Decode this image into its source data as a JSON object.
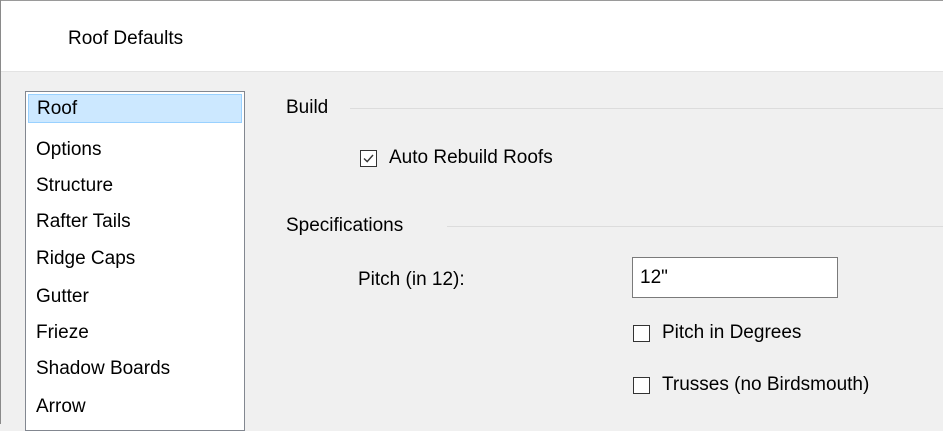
{
  "dialog": {
    "title": "Roof Defaults"
  },
  "sidebar": {
    "items": [
      {
        "label": "Roof",
        "selected": true
      },
      {
        "label": "Options",
        "selected": false
      },
      {
        "label": "Structure",
        "selected": false
      },
      {
        "label": "Rafter Tails",
        "selected": false
      },
      {
        "label": "Ridge Caps",
        "selected": false
      },
      {
        "label": "Gutter",
        "selected": false
      },
      {
        "label": "Frieze",
        "selected": false
      },
      {
        "label": "Shadow Boards",
        "selected": false
      },
      {
        "label": "Arrow",
        "selected": false
      }
    ]
  },
  "build": {
    "heading": "Build",
    "auto_rebuild": {
      "label": "Auto Rebuild Roofs",
      "checked": true
    }
  },
  "specifications": {
    "heading": "Specifications",
    "pitch": {
      "label": "Pitch (in 12):",
      "value": "12\""
    },
    "pitch_in_degrees": {
      "label": "Pitch in Degrees",
      "checked": false
    },
    "trusses": {
      "label": "Trusses (no Birdsmouth)",
      "checked": false
    }
  },
  "colors": {
    "selection_bg": "#cce8ff",
    "selection_border": "#99d1ff",
    "dialog_bg": "#f0f0f0"
  }
}
